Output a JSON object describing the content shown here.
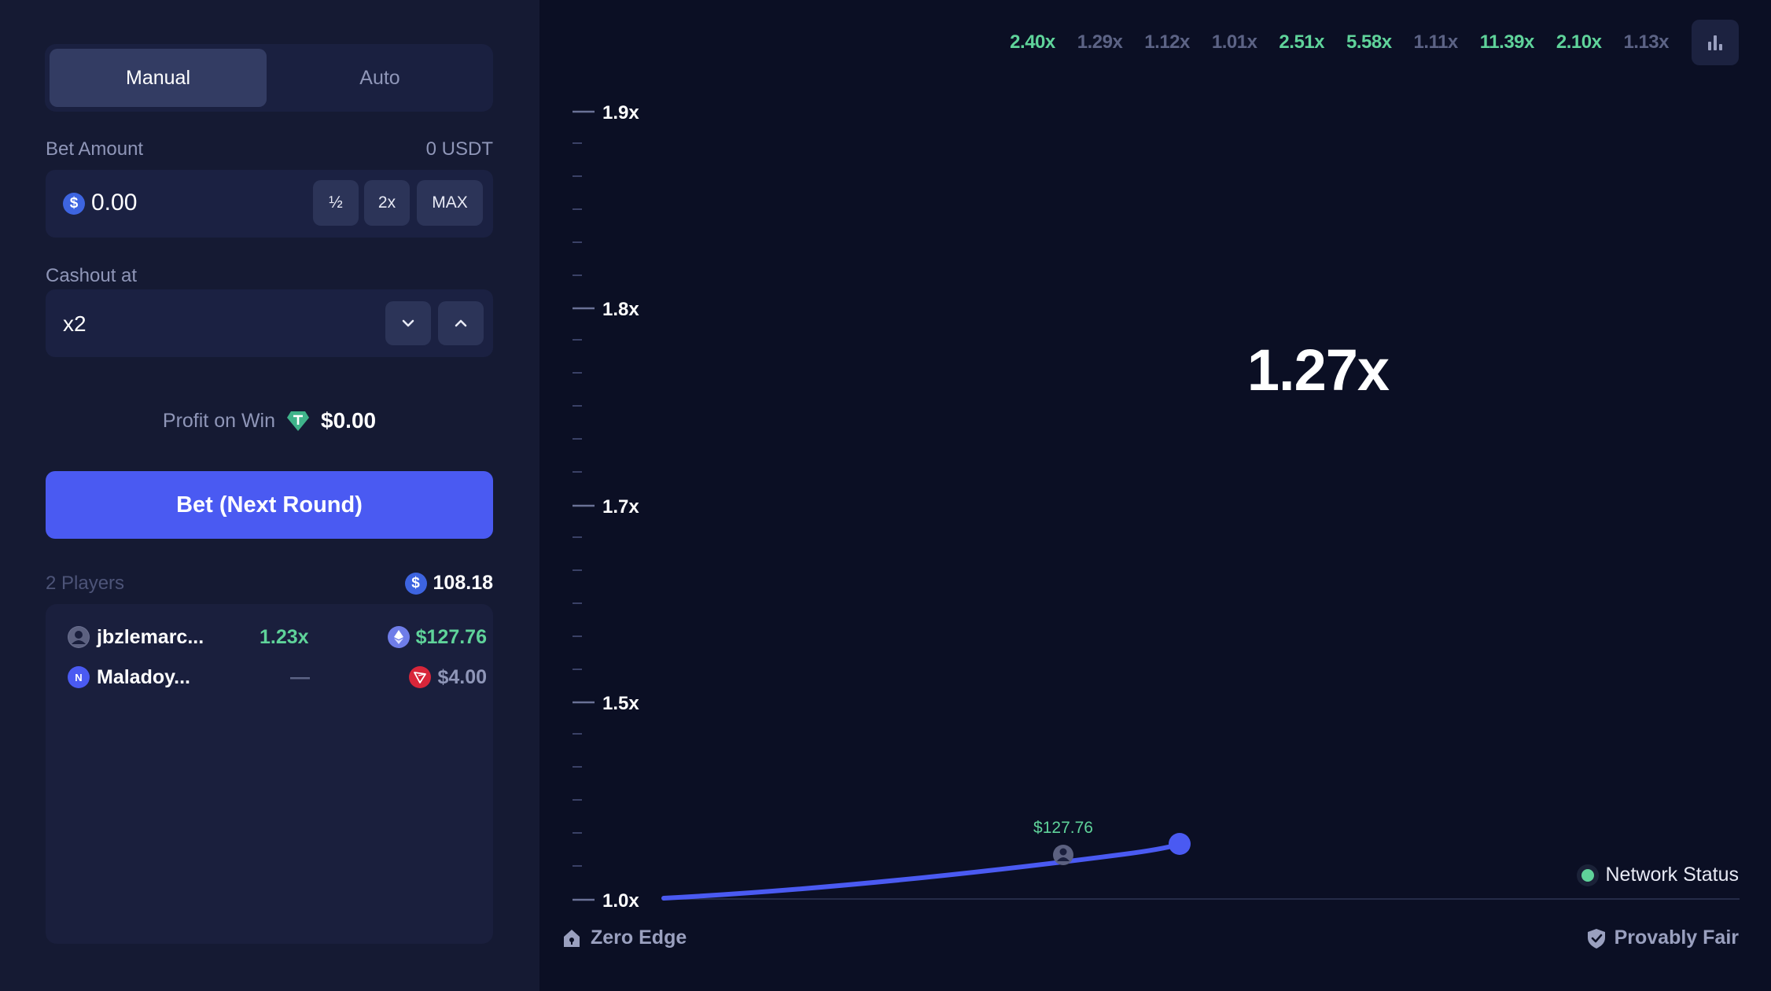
{
  "sidebar": {
    "mode_tabs": [
      {
        "label": "Manual",
        "active": true
      },
      {
        "label": "Auto",
        "active": false
      }
    ],
    "bet_amount": {
      "label": "Bet Amount",
      "balance": "0 USDT",
      "value": "0.00",
      "currency_icon": "dollar-coin-icon",
      "buttons": {
        "half": "½",
        "double": "2x",
        "max": "MAX"
      }
    },
    "cashout": {
      "label": "Cashout at",
      "value": "x2"
    },
    "profit": {
      "label": "Profit on Win",
      "value": "$0.00",
      "icon": "tether-gem-icon"
    },
    "bet_button_label": "Bet (Next Round)",
    "players": {
      "count_label": "2 Players",
      "total": "108.18",
      "list": [
        {
          "name": "jbzlemarc...",
          "multiplier": "1.23x",
          "amount": "$127.76",
          "currency_icon": "ethereum-icon",
          "avatar": "user-avatar-icon"
        },
        {
          "name": "Maladoy...",
          "multiplier": "—",
          "amount": "$4.00",
          "currency_icon": "tron-icon",
          "avatar": "n-avatar-icon"
        }
      ]
    }
  },
  "game": {
    "history": [
      {
        "value": "2.40x",
        "status": "high"
      },
      {
        "value": "1.29x",
        "status": "low"
      },
      {
        "value": "1.12x",
        "status": "low"
      },
      {
        "value": "1.01x",
        "status": "low"
      },
      {
        "value": "2.51x",
        "status": "high"
      },
      {
        "value": "5.58x",
        "status": "high"
      },
      {
        "value": "1.11x",
        "status": "low"
      },
      {
        "value": "11.39x",
        "status": "high"
      },
      {
        "value": "2.10x",
        "status": "high"
      },
      {
        "value": "1.13x",
        "status": "low"
      }
    ],
    "current_multiplier": "1.27x",
    "axis_labels": [
      "1.9x",
      "1.8x",
      "1.7x",
      "1.5x",
      "1.0x"
    ],
    "cashout_marker_label": "$127.76",
    "network_status_label": "Network Status",
    "footer_left": "Zero Edge",
    "footer_right": "Provably Fair"
  },
  "colors": {
    "accent": "#4a5af2",
    "win": "#5fd39a",
    "muted": "#5c6385",
    "sidebar_bg": "#151a33",
    "game_bg": "#0b0f24"
  }
}
